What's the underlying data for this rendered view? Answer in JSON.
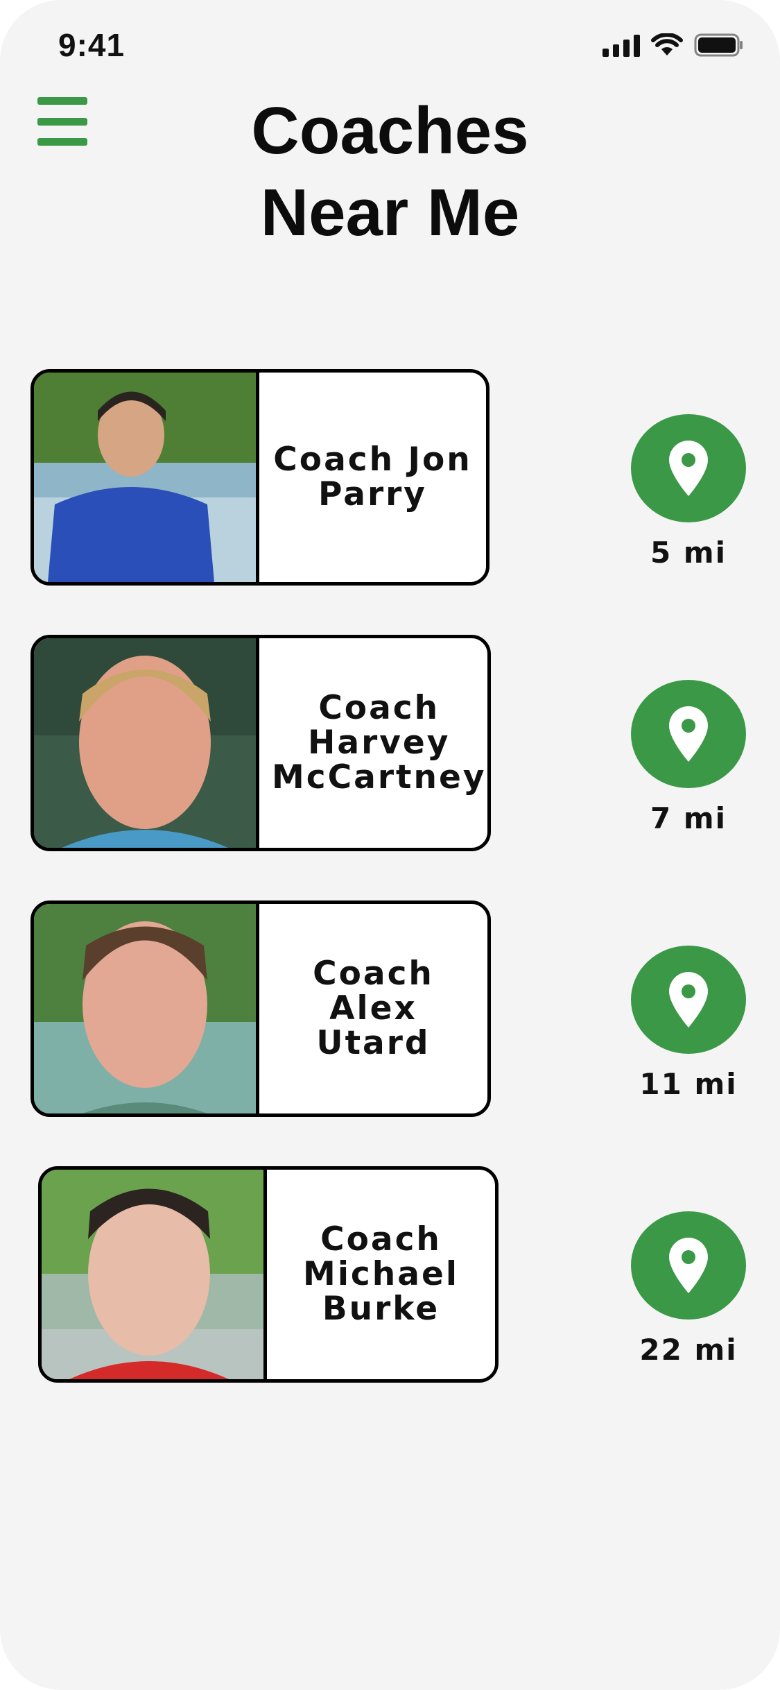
{
  "status_bar": {
    "time": "9:41"
  },
  "header": {
    "title_line1": "Coaches",
    "title_line2": "Near Me",
    "menu_icon": "hamburger-menu-icon"
  },
  "colors": {
    "accent": "#3a9846",
    "background": "#f4f4f4",
    "card_border": "#000000"
  },
  "coaches": [
    {
      "name": "Coach Jon Parry",
      "distance": "5 mi",
      "shirt_color": "#2a4fb8"
    },
    {
      "name": "Coach Harvey McCartney",
      "distance": "7 mi",
      "shirt_color": "#4a9ac8"
    },
    {
      "name": "Coach Alex Utard",
      "distance": "11 mi",
      "shirt_color": "#5a8a7a"
    },
    {
      "name": "Coach Michael Burke",
      "distance": "22 mi",
      "shirt_color": "#d42a2a"
    }
  ]
}
